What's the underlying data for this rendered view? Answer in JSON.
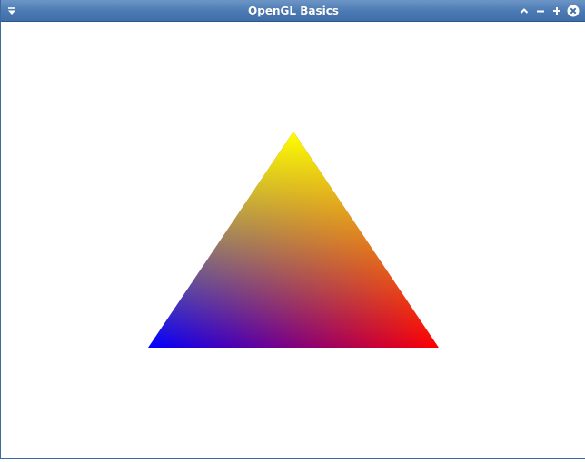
{
  "window": {
    "title": "OpenGL Basics"
  },
  "titlebar_buttons": [
    {
      "name": "window-menu",
      "icon": "menu-triangle-icon"
    },
    {
      "name": "shade",
      "icon": "chevron-up-icon"
    },
    {
      "name": "minimize",
      "icon": "minus-icon"
    },
    {
      "name": "maximize",
      "icon": "plus-icon"
    },
    {
      "name": "close",
      "icon": "close-circle-icon"
    }
  ],
  "scene": {
    "background_color": "#ffffff",
    "triangle": {
      "vertices": [
        {
          "label": "top",
          "color": "#ffff00"
        },
        {
          "label": "bottom-left",
          "color": "#0000ff"
        },
        {
          "label": "bottom-right",
          "color": "#ff0000"
        }
      ]
    }
  },
  "colors": {
    "titlebar": "#4a79b3",
    "title_text": "#ffffff"
  }
}
